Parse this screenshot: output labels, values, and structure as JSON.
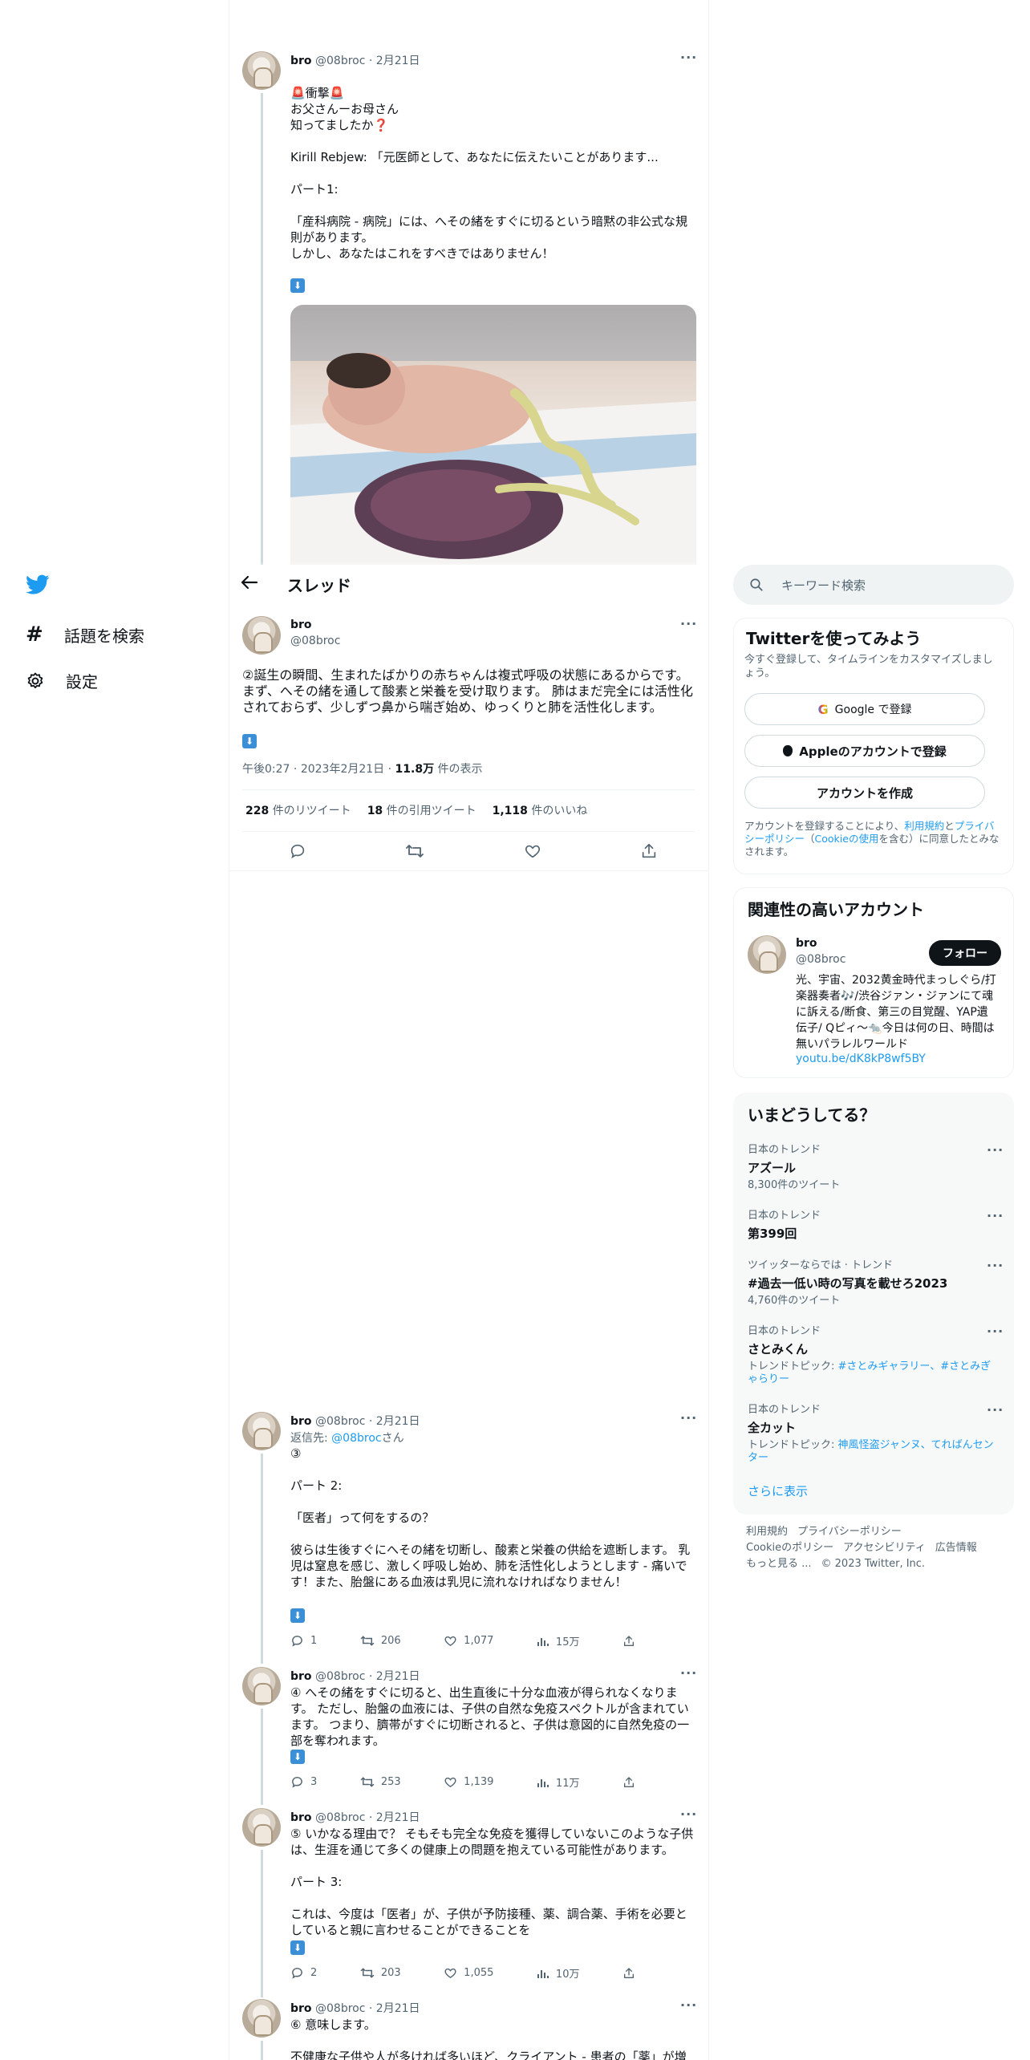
{
  "nav": {
    "explore": "話題を検索",
    "settings": "設定"
  },
  "thread_header": {
    "title": "スレッド"
  },
  "tweet1": {
    "name": "bro",
    "handle": "@08broc",
    "date": "2月21日",
    "line1_suffix": "衝撃",
    "body": "お父さんーお母さん\n知ってましたか❓\n\nKirill Rebjew: 「元医師として、あなたに伝えたいことがあります...\n\nパート1:\n\n「産科病院 - 病院」には、へその緒をすぐに切るという暗黙の非公式な規則があります。\n しかし、あなたはこれをすべきではありません！"
  },
  "main_tweet": {
    "name": "bro",
    "handle": "@08broc",
    "body": "②誕生の瞬間、生まれたばかりの赤ちゃんは複式呼吸の状態にあるからです。 まず、へその緒を通して酸素と栄養を受け取ります。 肺はまだ完全には活性化されておらず、少しずつ鼻から喘ぎ始め、ゆっくりと肺を活性化します。",
    "time": "午後0:27",
    "date": "2023年2月21日",
    "views_count": "11.8万",
    "views_label": "件の表示",
    "retweets_count": "228",
    "retweets_label": "件のリツイート",
    "quotes_count": "18",
    "quotes_label": "件の引用ツイート",
    "likes_count": "1,118",
    "likes_label": "件のいいね"
  },
  "replies": [
    {
      "name": "bro",
      "handle": "@08broc",
      "date": "2月21日",
      "reply_to_prefix": "返信先: ",
      "reply_to_handle": "@08broc",
      "reply_to_suffix": "さん",
      "body": "③\n\nパート 2:\n\n「医者」って何をするの？\n\n 彼らは生後すぐにへその緒を切断し、酸素と栄養の供給を遮断します。 乳児は窒息を感じ、激しく呼吸し始め、肺を活性化しようとします - 痛いです！また、胎盤にある血液は乳児に流れなければなりません！",
      "replies": "1",
      "retweets": "206",
      "likes": "1,077",
      "views": "15万"
    },
    {
      "name": "bro",
      "handle": "@08broc",
      "date": "2月21日",
      "body": "④ へその緒をすぐに切ると、出生直後に十分な血液が得られなくなります。 ただし、胎盤の血液には、子供の自然な免疫スペクトルが含まれています。 つまり、臍帯がすぐに切断されると、子供は意図的に自然免疫の一部を奪われます。",
      "replies": "3",
      "retweets": "253",
      "likes": "1,139",
      "views": "11万"
    },
    {
      "name": "bro",
      "handle": "@08broc",
      "date": "2月21日",
      "body": "⑤ いかなる理由で？ そもそも完全な免疫を獲得していないこのような子供は、生涯を通じて多くの健康上の問題を抱えている可能性があります。\n\n パート 3:\n\n これは、今度は「医者」が、子供が予防接種、薬、調合薬、手術を必要としていると親に言わせることができることを",
      "replies": "2",
      "retweets": "203",
      "likes": "1,055",
      "views": "10万"
    },
    {
      "name": "bro",
      "handle": "@08broc",
      "date": "2月21日",
      "body": "⑥ 意味します。\n\n 不健康な子供や人が多ければ多いほど、クライアント - 患者の「薬」が増"
    }
  ],
  "search": {
    "placeholder": "キーワード検索"
  },
  "signup": {
    "title": "Twitterを使ってみよう",
    "subtitle": "今すぐ登録して、タイムラインをカスタマイズしましょう。",
    "google": "Google で登録",
    "apple": "Appleのアカウントで登録",
    "create": "アカウントを作成",
    "terms_prefix": "アカウントを登録することにより、",
    "terms_link1": "利用規約",
    "terms_and": "と",
    "terms_link2": "プライバシーポリシー",
    "terms_paren_open": "（",
    "terms_link3": "Cookieの使用",
    "terms_suffix": "を含む）に同意したとみなされます。"
  },
  "related": {
    "title": "関連性の高いアカウント",
    "name": "bro",
    "handle": "@08broc",
    "follow": "フォロー",
    "bio": "光、宇宙、2032黄金時代まっしぐら/打楽器奏者🎶/渋谷ジァン・ジァンにて魂に訴える/断食、第三の目覚醒、YAP遺伝子/ Qピィ〜🐀今日は何の日、時間は無いパラレルワールド",
    "link": "youtu.be/dK8kP8wf5BY"
  },
  "trends": {
    "title": "いまどうしてる？",
    "items": [
      {
        "meta": "日本のトレンド",
        "name": "アズール",
        "sub": "8,300件のツイート"
      },
      {
        "meta": "日本のトレンド",
        "name": "第399回",
        "sub": ""
      },
      {
        "meta": "ツイッターならでは · トレンド",
        "name": "#過去一低い時の写真を載せろ2023",
        "sub": "4,760件のツイート"
      },
      {
        "meta": "日本のトレンド",
        "name": "さとみくん",
        "sub_prefix": "トレンドトピック: ",
        "sub_links": "#さとみギャラリー、#さとみぎゃらりー"
      },
      {
        "meta": "日本のトレンド",
        "name": "全カット",
        "sub_prefix": "トレンドトピック: ",
        "sub_links": "神風怪盗ジャンヌ、てればんセンター"
      }
    ],
    "show_more": "さらに表示"
  },
  "footer": {
    "line1": [
      "利用規約",
      "プライバシーポリシー"
    ],
    "line2": [
      "Cookieのポリシー",
      "アクセシビリティ",
      "広告情報"
    ],
    "more": "もっと見る ...",
    "copyright": "© 2023 Twitter, Inc."
  },
  "colors": {
    "accent": "#1d9bf0",
    "text": "#0f1419",
    "muted": "#536471"
  }
}
